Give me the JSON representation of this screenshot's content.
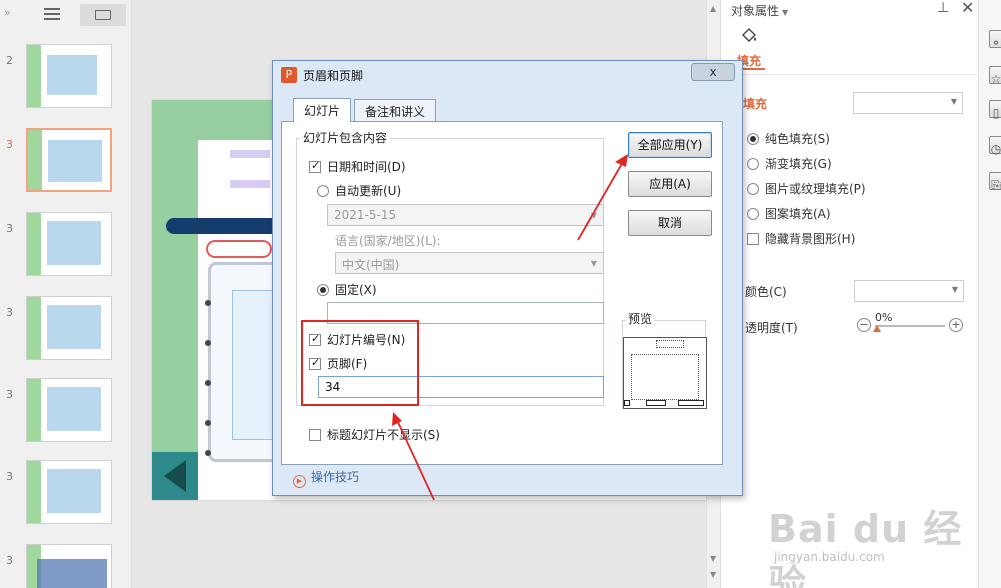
{
  "left_pane": {
    "slides": [
      {
        "number": "2"
      },
      {
        "number": "3"
      },
      {
        "number": "3"
      },
      {
        "number": "3"
      },
      {
        "number": "3"
      },
      {
        "number": "3"
      },
      {
        "number": "3"
      }
    ]
  },
  "dialog": {
    "title": "页眉和页脚",
    "close_label": "x",
    "tabs": [
      {
        "label": "幻灯片"
      },
      {
        "label": "备注和讲义"
      }
    ],
    "group_title": "幻灯片包含内容",
    "date_time_label": "日期和时间(D)",
    "date_time_checked": true,
    "auto_update_label": "自动更新(U)",
    "date_value": "2021-5-15",
    "language_label": "语言(国家/地区)(L):",
    "language_value": "中文(中国)",
    "fixed_label": "固定(X)",
    "fixed_value": "",
    "slide_number_label": "幻灯片编号(N)",
    "slide_number_checked": true,
    "footer_label": "页脚(F)",
    "footer_checked": true,
    "footer_value": "34",
    "hide_title_label": "标题幻灯片不显示(S)",
    "hide_title_checked": false,
    "apply_all_button": "全部应用(Y)",
    "apply_button": "应用(A)",
    "cancel_button": "取消",
    "preview_label": "预览",
    "tips_label": "操作技巧"
  },
  "right_panel": {
    "title": "对象属性",
    "tab_fill": "填充",
    "section_fill": "填充",
    "options": [
      {
        "label": "纯色填充(S)",
        "selected": true
      },
      {
        "label": "渐变填充(G)",
        "selected": false
      },
      {
        "label": "图片或纹理填充(P)",
        "selected": false
      },
      {
        "label": "图案填充(A)",
        "selected": false
      }
    ],
    "hide_bg_label": "隐藏背景图形(H)",
    "color_label": "颜色(C)",
    "transparency_label": "透明度(T)",
    "transparency_value": "0%"
  },
  "watermark": {
    "logo": "Bai du 经验",
    "url": "jingyan.baidu.com"
  }
}
